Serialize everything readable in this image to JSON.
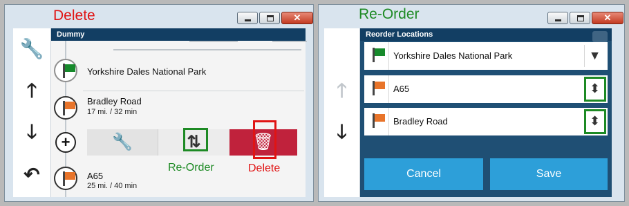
{
  "left_panel": {
    "label": "Delete",
    "window_buttons": [
      "minimize-icon",
      "maximize-icon",
      "close-icon"
    ],
    "header_title": "Dummy",
    "sidebar_icons": [
      "wrench-icon",
      "arrow-up-icon",
      "arrow-down-icon",
      "undo-icon"
    ],
    "items": [
      {
        "name": "Yorkshire Dales National Park",
        "sub": "",
        "flag": "green"
      },
      {
        "name": "Bradley Road",
        "sub": "17 mi. / 32 min",
        "flag": "orange"
      },
      {
        "name": "A65",
        "sub": "25 mi. / 40 min",
        "flag": "orange"
      }
    ],
    "actions": [
      "wrench-icon",
      "reorder-icon",
      "trash-icon"
    ],
    "captions": {
      "reorder": "Re-Order",
      "delete": "Delete"
    }
  },
  "right_panel": {
    "label": "Re-Order",
    "window_buttons": [
      "minimize-icon",
      "maximize-icon",
      "close-icon"
    ],
    "header_title": "Reorder Locations",
    "sidebar_icons": [
      "arrow-up-icon",
      "arrow-down-icon"
    ],
    "items": [
      {
        "name": "Yorkshire Dales National Park",
        "flag": "green"
      },
      {
        "name": "A65",
        "flag": "orange"
      },
      {
        "name": "Bradley Road",
        "flag": "orange"
      }
    ],
    "buttons": {
      "cancel": "Cancel",
      "save": "Save"
    }
  },
  "colors": {
    "header": "#123e63",
    "delete_red": "#c0223c",
    "highlight_green": "#1d8a24",
    "highlight_red": "#e01414",
    "button_blue": "#2d9fd9"
  }
}
